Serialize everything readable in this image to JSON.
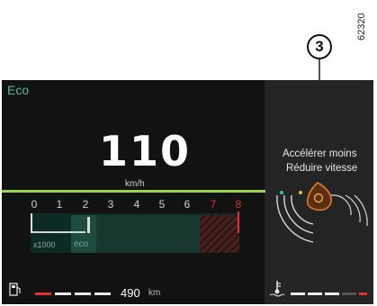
{
  "figure": {
    "ref_code": "62320",
    "callout_number": "3"
  },
  "cluster": {
    "mode": "Eco",
    "speed": {
      "value": "110",
      "unit": "km/h"
    },
    "messages": [
      "Accélérer moins",
      "Réduire vitesse"
    ],
    "tachometer": {
      "ticks": [
        "0",
        "1",
        "2",
        "3",
        "4",
        "5",
        "6",
        "7",
        "8"
      ],
      "redline_ticks": [
        "7",
        "8"
      ],
      "scale_label": "x1000",
      "eco_label": "eco",
      "current_rpm": 2.0
    },
    "fuel": {
      "range_value": "490",
      "range_unit": "km",
      "icon": "fuel-pump-icon"
    },
    "coolant": {
      "icon": "coolant-temperature-icon"
    },
    "colors": {
      "accent_green": "#9bd44b",
      "eco_text": "#4fbf9a",
      "redline": "#e0332e",
      "advice_orange": "#e07a2a"
    }
  }
}
